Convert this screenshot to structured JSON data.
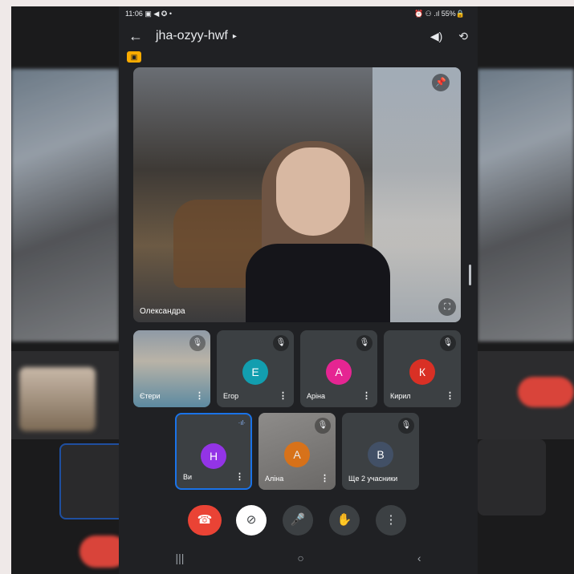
{
  "status": {
    "time": "11:06",
    "left_icons": "▣ ◀ ✪ •",
    "right_icons": "⏰ ⚇ .ıl",
    "battery": "55%🔒"
  },
  "meeting": {
    "code": "jha-ozyy-hwf",
    "back_icon": "←",
    "caret": "▸",
    "speaker_icon": "◀)",
    "camera_switch_icon": "⟲",
    "badge": "▣"
  },
  "main_speaker": {
    "name": "Олександра",
    "pin_icon": "📌",
    "fullscreen_icon": "⛶"
  },
  "tiles_row1": [
    {
      "name": "Єтери",
      "avatar": "",
      "color": "",
      "video": true
    },
    {
      "name": "Егор",
      "avatar": "E",
      "color": "#129eaf"
    },
    {
      "name": "Аріна",
      "avatar": "А",
      "color": "#e52592"
    },
    {
      "name": "Кирил",
      "avatar": "К",
      "color": "#d93025"
    }
  ],
  "tiles_row2": [
    {
      "name": "Ви",
      "avatar": "Н",
      "color": "#9334e6",
      "active": true
    },
    {
      "name": "Аліна",
      "avatar": "А",
      "color": "#e8710a",
      "video": true
    },
    {
      "name": "Ще 2 учасники",
      "avatar": "В",
      "color": "#425066"
    }
  ],
  "icons": {
    "mute": "🎙",
    "more": "⋮",
    "end": "☎",
    "camera_off": "⊘",
    "mic": "🎤",
    "hand": "✋",
    "menu": "⋮",
    "speak": "·ıl·"
  },
  "nav": {
    "recent": "|||",
    "home": "○",
    "back": "‹"
  },
  "colors": {
    "accent": "#1a73e8",
    "end_call": "#ea4335",
    "bg": "#202124",
    "tile": "#3c4043"
  }
}
